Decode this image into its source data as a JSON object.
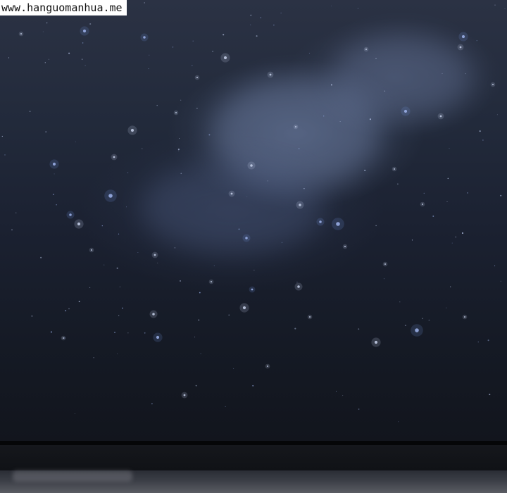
{
  "watermark": {
    "text": "www.hanguomanhua.me"
  },
  "scene": {
    "colors": {
      "sky_top": "#2b3244",
      "sky_bottom": "#12151d",
      "star_blue": "#6f8fd6",
      "star_white": "#c9d3ec",
      "floor_dark": "#101216",
      "bottom_band": "#5a5c63"
    }
  }
}
